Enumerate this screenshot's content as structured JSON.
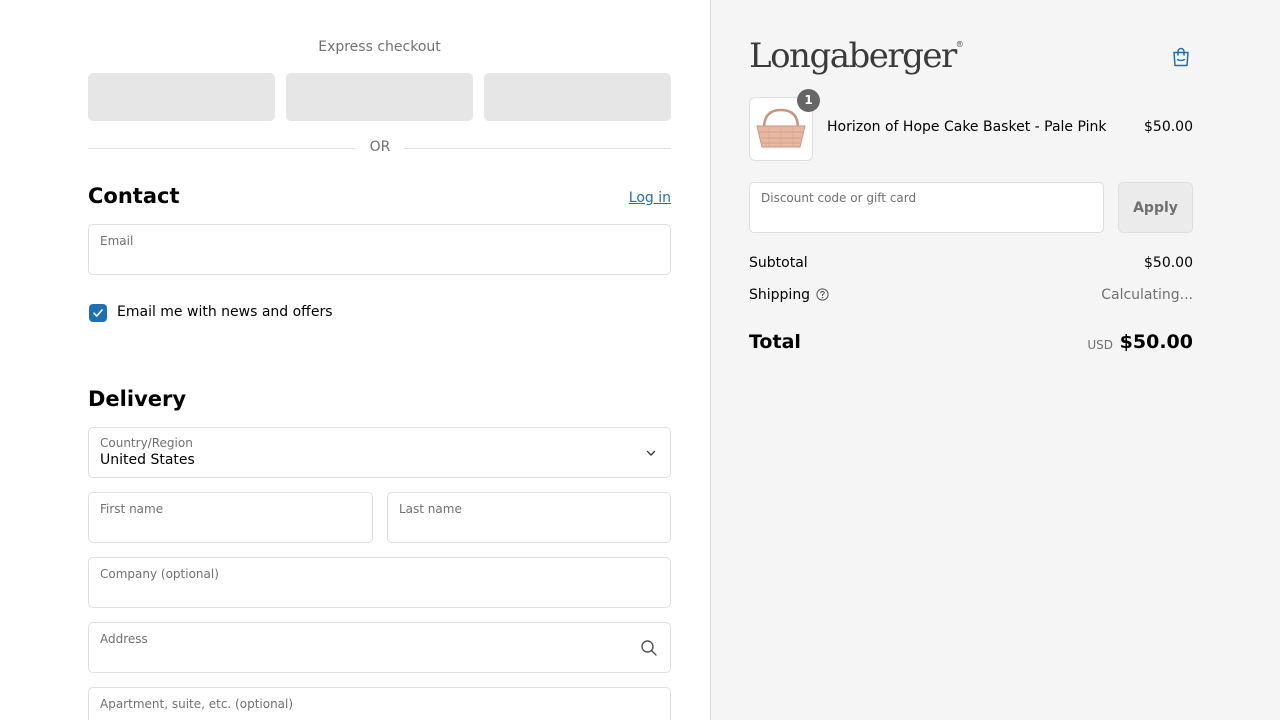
{
  "express": {
    "title": "Express checkout",
    "or": "OR"
  },
  "contact": {
    "heading": "Contact",
    "login": "Log in",
    "email_label": "Email",
    "news_label": "Email me with news and offers",
    "news_checked": true
  },
  "delivery": {
    "heading": "Delivery",
    "country_label": "Country/Region",
    "country_value": "United States",
    "first_name_label": "First name",
    "last_name_label": "Last name",
    "company_label": "Company (optional)",
    "address_label": "Address",
    "apartment_label": "Apartment, suite, etc. (optional)"
  },
  "summary": {
    "brand": "Longaberger",
    "brand_mark": "®",
    "item": {
      "quantity": "1",
      "name": "Horizon of Hope Cake Basket - Pale Pink",
      "price": "$50.00"
    },
    "discount_label": "Discount code or gift card",
    "apply": "Apply",
    "subtotal_label": "Subtotal",
    "subtotal_value": "$50.00",
    "shipping_label": "Shipping",
    "shipping_value": "Calculating...",
    "total_label": "Total",
    "currency": "USD",
    "total_value": "$50.00"
  },
  "colors": {
    "accent": "#1f6fb5",
    "sidebar_bg": "#f5f5f5",
    "border": "#dedede",
    "muted": "#707070"
  }
}
